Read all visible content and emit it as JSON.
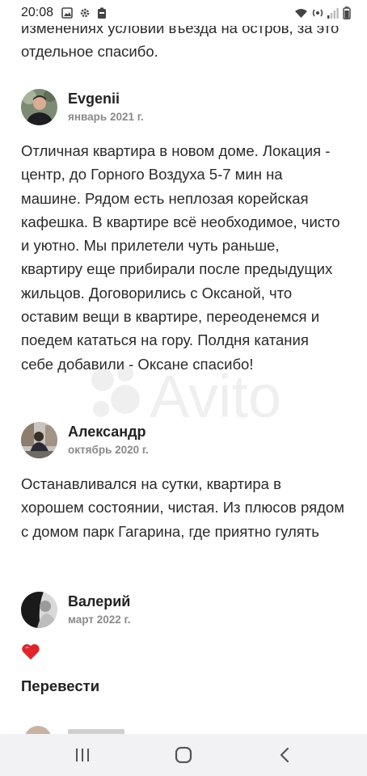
{
  "status_bar": {
    "time": "20:08",
    "left_icons": [
      "gallery-icon",
      "settings-gear-icon",
      "battery-saver-icon"
    ],
    "right_icons": [
      "wifi-icon",
      "hotspot-icon",
      "signal-icon",
      "battery-icon"
    ]
  },
  "previous_review_tail": "изменениях условий въезда на остров, за это отдельное спасибо.",
  "reviews": [
    {
      "name": "Evgenii",
      "date": "январь 2021 г.",
      "text": "Отличная квартира в новом доме. Локация - центр, до Горного Воздуха 5-7 мин на машине. Рядом есть неплозая корейская кафешка. В квартире всё необходимое, чисто и уютно. Мы прилетели чуть раньше, квартиру еще прибирали после предыдущих жильцов. Договорились с Оксаной, что оставим вещи в квартире, переоденемся и поедем кататься на гору. Полдня катания себе добавили - Оксане спасибо!"
    },
    {
      "name": "Александр",
      "date": "октябрь 2020 г.",
      "text": "Останавливался на сутки, квартира в хорошем состоянии, чистая. Из плюсов рядом с домом парк Гагарина, где приятно гулять"
    },
    {
      "name": "Валерий",
      "date": "март 2022 г.",
      "emoji": "❤️"
    }
  ],
  "translate_label": "Перевести",
  "watermark": "Avito",
  "colors": {
    "text": "#2a2a2a",
    "date": "#8a8a8a",
    "heart": "#e0242c",
    "nav_bar": "#f2f2f4"
  },
  "nav_bar": {
    "buttons": [
      "recent-apps",
      "home",
      "back"
    ]
  }
}
